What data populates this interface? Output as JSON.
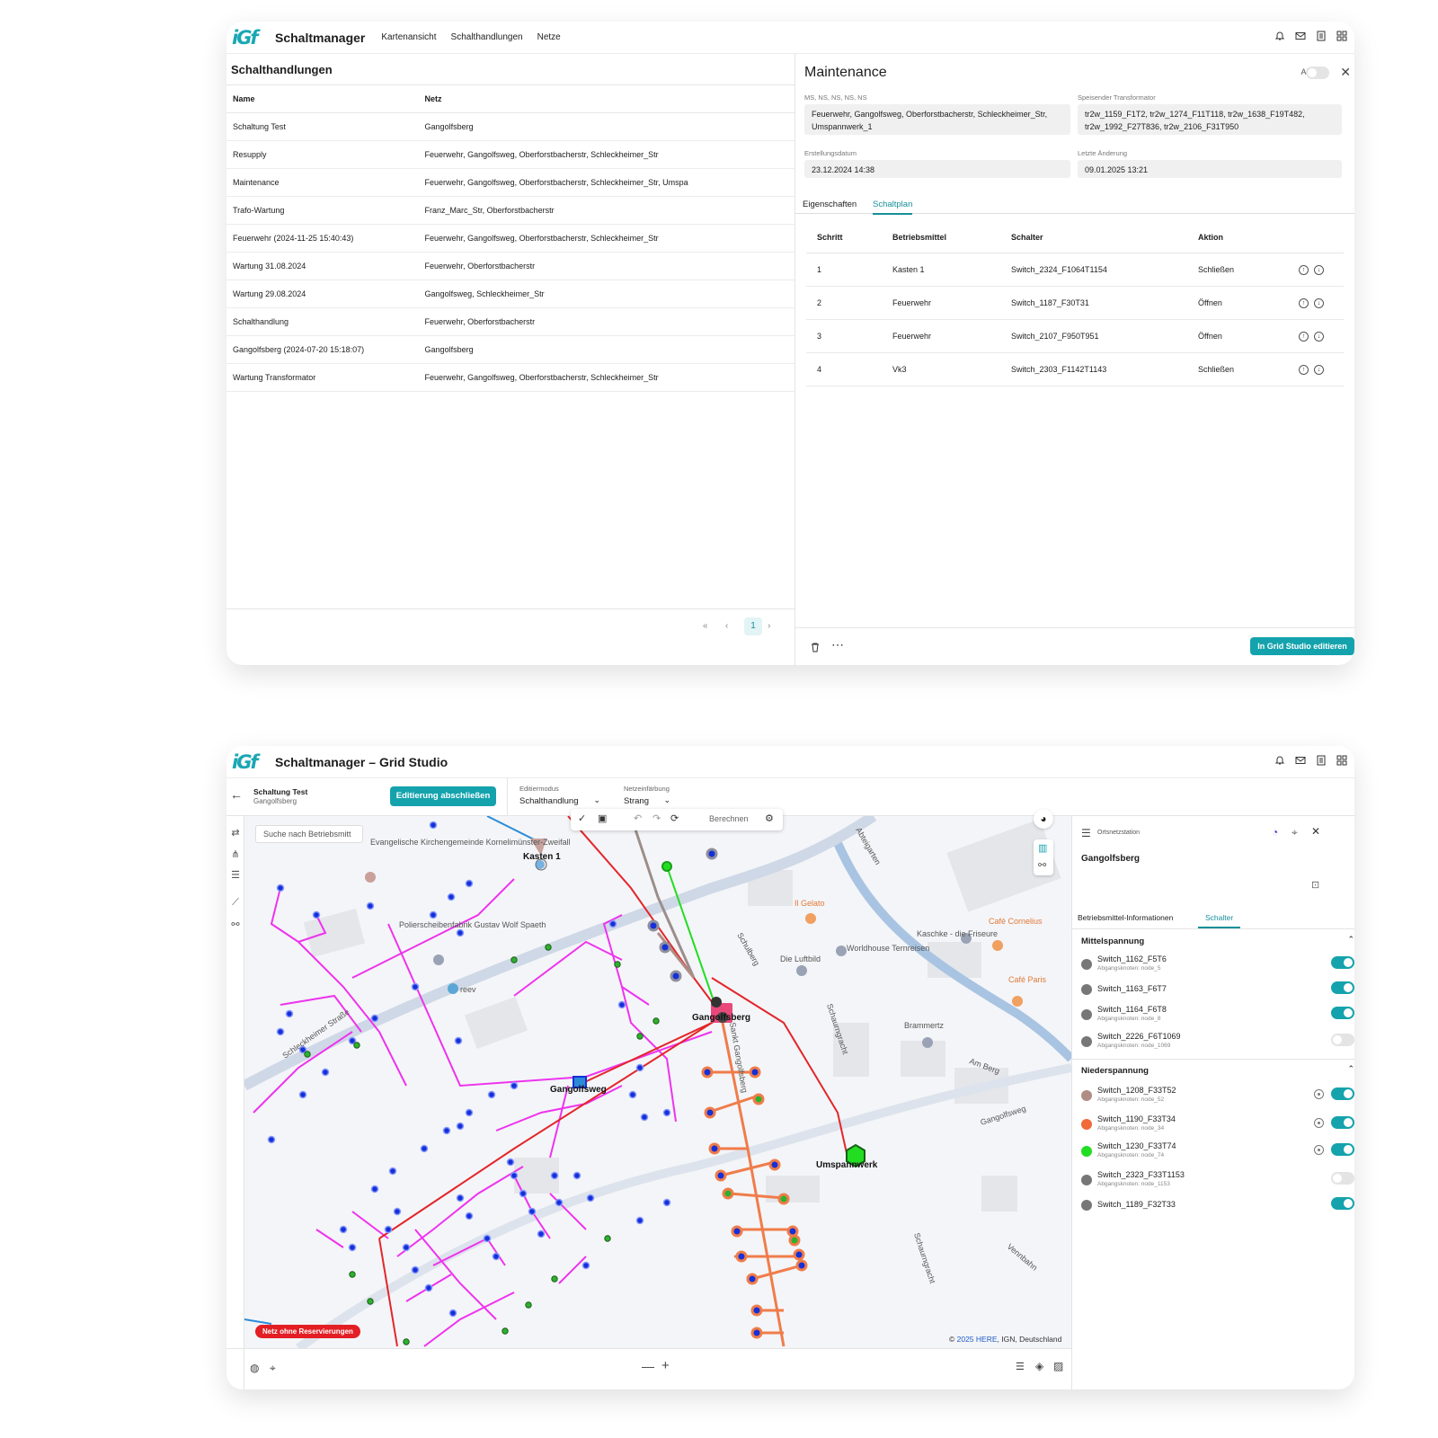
{
  "card1": {
    "logo": "iGf",
    "app_title": "Schaltmanager",
    "nav": [
      "Kartenansicht",
      "Schalthandlungen",
      "Netze"
    ],
    "table_title": "Schalthandlungen",
    "columns": {
      "name": "Name",
      "netz": "Netz"
    },
    "rows": [
      {
        "name": "Schaltung Test",
        "netz": "Gangolfsberg"
      },
      {
        "name": "Resupply",
        "netz": "Feuerwehr, Gangolfsweg, Oberforstbacherstr, Schleckheimer_Str"
      },
      {
        "name": "Maintenance",
        "netz": "Feuerwehr, Gangolfsweg, Oberforstbacherstr, Schleckheimer_Str, Umspa"
      },
      {
        "name": "Trafo-Wartung",
        "netz": "Franz_Marc_Str, Oberforstbacherstr"
      },
      {
        "name": "Feuerwehr (2024-11-25 15:40:43)",
        "netz": "Feuerwehr, Gangolfsweg, Oberforstbacherstr, Schleckheimer_Str"
      },
      {
        "name": "Wartung 31.08.2024",
        "netz": "Feuerwehr, Oberforstbacherstr"
      },
      {
        "name": "Wartung 29.08.2024",
        "netz": "Gangolfsweg, Schleckheimer_Str"
      },
      {
        "name": "Schalthandlung",
        "netz": "Feuerwehr, Oberforstbacherstr"
      },
      {
        "name": "Gangolfsberg (2024-07-20 15:18:07)",
        "netz": "Gangolfsberg"
      },
      {
        "name": "Wartung Transformator",
        "netz": "Feuerwehr, Gangolfsweg, Oberforstbacherstr, Schleckheimer_Str"
      }
    ],
    "pager": {
      "first": "«",
      "prev": "‹",
      "page": "1",
      "next": "›"
    },
    "detail": {
      "title": "Maintenance",
      "aktiv_label": "Aktiv",
      "close": "✕",
      "netz_label": "MS, NS, NS, NS, NS",
      "netz_value_1": "Feuerwehr, Gangolfsweg, Oberforstbacherstr, Schleckheimer_Str,",
      "netz_value_2": "Umspannwerk_1",
      "trafo_label": "Speisender Transformator",
      "trafo_value_1": "tr2w_1159_F1T2, tr2w_1274_F11T118, tr2w_1638_F19T482,",
      "trafo_value_2": "tr2w_1992_F27T836, tr2w_2106_F31T950",
      "created_label": "Erstellungsdatum",
      "created_value": "23.12.2024 14:38",
      "changed_label": "Letzte Änderung",
      "changed_value": "09.01.2025 13:21",
      "tabs": [
        "Eigenschaften",
        "Schaltplan"
      ],
      "active_tab": "Schaltplan",
      "step_columns": [
        "Schritt",
        "Betriebsmittel",
        "Schalter",
        "Aktion"
      ],
      "steps": [
        {
          "n": "1",
          "bm": "Kasten 1",
          "sw": "Switch_2324_F1064T1154",
          "act": "Schließen"
        },
        {
          "n": "2",
          "bm": "Feuerwehr",
          "sw": "Switch_1187_F30T31",
          "act": "Öffnen"
        },
        {
          "n": "3",
          "bm": "Feuerwehr",
          "sw": "Switch_2107_F950T951",
          "act": "Öffnen"
        },
        {
          "n": "4",
          "bm": "Vk3",
          "sw": "Switch_2303_F1142T1143",
          "act": "Schließen"
        }
      ],
      "edit_button": "In Grid Studio editieren"
    }
  },
  "card2": {
    "logo": "iGf",
    "app_title": "Schaltmanager – Grid Studio",
    "schaltung_title": "Schaltung Test",
    "schaltung_sub": "Gangolfsberg",
    "finish_button": "Editierung abschließen",
    "edit_mode_label": "Editiermodus",
    "edit_mode_value": "Schalthandlung",
    "color_label": "Netzeinfärbung",
    "color_value": "Strang",
    "search_placeholder": "Suche nach Betriebsmitt",
    "calc_label": "Berechnen",
    "reservation_badge": "Netz ohne Reservierungen",
    "copyright_prefix": "© ",
    "copyright_link": "2025 HERE",
    "copyright_rest": ", IGN, Deutschland",
    "map_labels": {
      "kasten": "Kasten 1",
      "gangolfsberg": "Gangolfsberg",
      "gangolfsweg": "Gangolfsweg",
      "umspannwerk": "Umspannwerk",
      "schleckheimer": "Schleckheimer Straße",
      "sankt": "Sankt Gangolfsberg",
      "schulberg": "Schulberg",
      "schaurngracht": "Schaurngracht",
      "vennbahn": "Vennbahn",
      "amberg": "Am Berg",
      "abteigarten": "Abteigarten",
      "ilgelato": "Il Gelato",
      "cafecornelius": "Café Cornelius",
      "cafeparis": "Café Paris",
      "worldhouse": "Worldhouse Ternreisen",
      "kaschke": "Kaschke - die Friseure",
      "luftbild": "Die Luftbild",
      "brammertz": "Brammertz",
      "kirche": "Evangelische Kirchengemeinde Kornelimünster-Zweifall",
      "polier": "Polierscheibenfabrik Gustav Wolf Spaeth",
      "reev": "reev"
    },
    "panel": {
      "type_label": "Ortsnetzstation",
      "station": "Gangolfsberg",
      "tabs": [
        "Betriebsmittel-Informationen",
        "Schalter"
      ],
      "active_tab": "Schalter",
      "mittel_title": "Mittelspannung",
      "mittel": [
        {
          "name": "Switch_1162_F5T6",
          "sub": "Abgangsknoten: node_5",
          "color": "#777777",
          "on": true
        },
        {
          "name": "Switch_1163_F6T7",
          "sub": "",
          "color": "#777777",
          "on": true
        },
        {
          "name": "Switch_1164_F6T8",
          "sub": "Abgangsknoten: node_8",
          "color": "#777777",
          "on": true
        },
        {
          "name": "Switch_2226_F6T1069",
          "sub": "Abgangsknoten: node_1069",
          "color": "#777777",
          "on": false
        }
      ],
      "nieder_title": "Niederspannung",
      "nieder": [
        {
          "name": "Switch_1208_F33T52",
          "sub": "Abgangsknoten: node_52",
          "color": "#b08c85",
          "on": true,
          "target": true
        },
        {
          "name": "Switch_1190_F33T34",
          "sub": "Abgangsknoten: node_34",
          "color": "#f06a3a",
          "on": true,
          "target": true
        },
        {
          "name": "Switch_1230_F33T74",
          "sub": "Abgangsknoten: node_74",
          "color": "#22dd22",
          "on": true,
          "target": true
        },
        {
          "name": "Switch_2323_F33T1153",
          "sub": "Abgangsknoten: node_1153",
          "color": "#777777",
          "on": false,
          "target": false
        },
        {
          "name": "Switch_1189_F32T33",
          "sub": "",
          "color": "#777777",
          "on": true,
          "target": false
        }
      ]
    }
  }
}
